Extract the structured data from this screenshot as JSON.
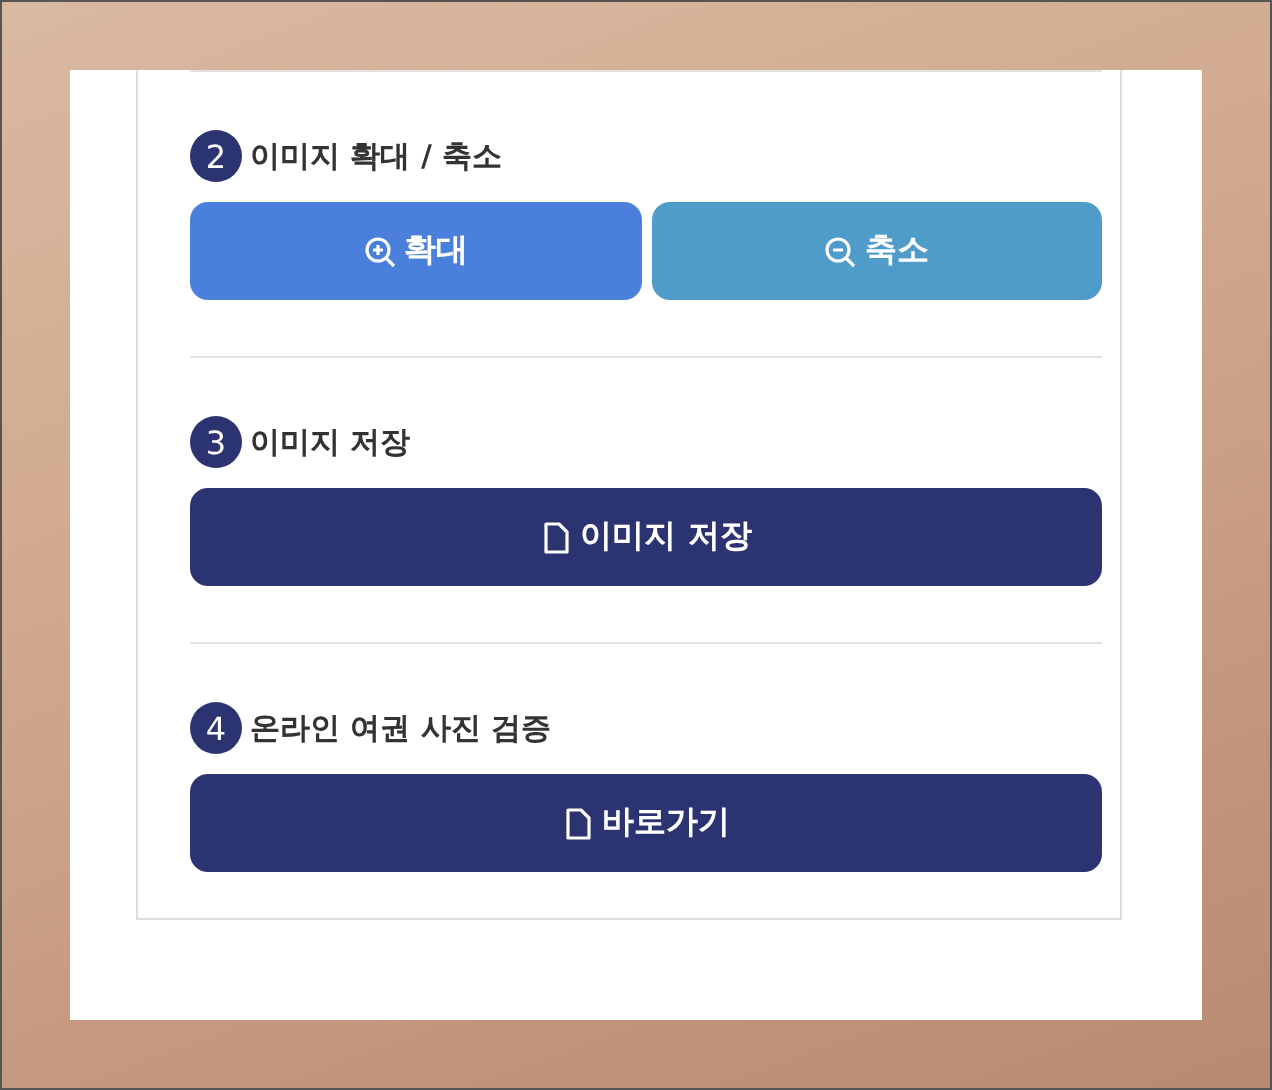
{
  "sections": [
    {
      "number": "2",
      "title": "이미지 확대 / 축소",
      "buttons": [
        {
          "label": "확대",
          "kind": "zoom-in",
          "color": "#4a80dc"
        },
        {
          "label": "축소",
          "kind": "zoom-out",
          "color": "#4f9bc9"
        }
      ]
    },
    {
      "number": "3",
      "title": "이미지 저장",
      "buttons": [
        {
          "label": "이미지 저장",
          "kind": "file",
          "color": "#2b3370"
        }
      ]
    },
    {
      "number": "4",
      "title": "온라인 여권 사진 검증",
      "buttons": [
        {
          "label": "바로가기",
          "kind": "file",
          "color": "#2b3370"
        }
      ]
    }
  ]
}
